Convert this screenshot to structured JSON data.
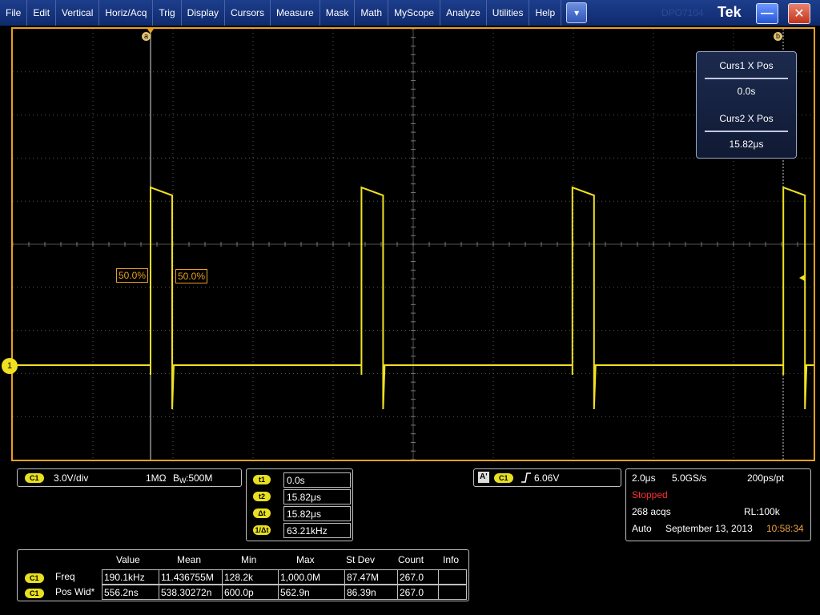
{
  "menu": [
    "File",
    "Edit",
    "Vertical",
    "Horiz/Acq",
    "Trig",
    "Display",
    "Cursors",
    "Measure",
    "Mask",
    "Math",
    "MyScope",
    "Analyze",
    "Utilities",
    "Help"
  ],
  "titlebar": {
    "model": "DPO7104",
    "brand": "Tek",
    "toggle_icon": "▾",
    "minimize_icon": "—",
    "close_icon": "✕"
  },
  "graticule": {
    "cursor_a_label": "a",
    "cursor_b_label": "b",
    "pct_left": "50.0%",
    "pct_right": "50.0%",
    "channel_marker": "1",
    "border_color": "#e8a020",
    "trace_color": "#f0e020"
  },
  "cursor_readout": {
    "curs1_title": "Curs1 X Pos",
    "curs1_value": "0.0s",
    "curs2_title": "Curs2 X Pos",
    "curs2_value": "15.82μs"
  },
  "channel_panel": {
    "badge": "C1",
    "scale": "3.0V/div",
    "impedance": "1MΩ",
    "bw_label": "W",
    "bw_prefix": "B",
    "bandwidth": ":500M"
  },
  "cursor_panel": {
    "rows": [
      {
        "label": "t1",
        "value": "0.0s"
      },
      {
        "label": "t2",
        "value": "15.82μs"
      },
      {
        "label": "Δt",
        "value": "15.82μs"
      },
      {
        "label": "1/Δt",
        "value": "63.21kHz"
      }
    ]
  },
  "trigger_panel": {
    "source_tag": "A'",
    "badge": "C1",
    "slope_icon": "rising-edge",
    "level": "6.06V"
  },
  "acq_panel": {
    "timebase": "2.0μs",
    "sample_rate": "5.0GS/s",
    "resolution": "200ps/pt",
    "status": "Stopped",
    "acqs": "268 acqs",
    "record_length": "RL:100k",
    "mode": "Auto",
    "date": "September 13, 2013",
    "time": "10:58:34"
  },
  "measurements": {
    "headers": [
      "Value",
      "Mean",
      "Min",
      "Max",
      "St Dev",
      "Count",
      "Info"
    ],
    "rows": [
      {
        "badge": "C1",
        "name": "Freq",
        "value": "190.1kHz",
        "mean": "11.436755M",
        "min": "128.2k",
        "max": "1,000.0M",
        "stdev": "87.47M",
        "count": "267.0",
        "info": ""
      },
      {
        "badge": "C1",
        "name": "Pos Wid*",
        "value": "556.2ns",
        "mean": "538.30272n",
        "min": "600.0p",
        "max": "562.9n",
        "stdev": "86.39n",
        "count": "267.0",
        "info": ""
      }
    ]
  }
}
